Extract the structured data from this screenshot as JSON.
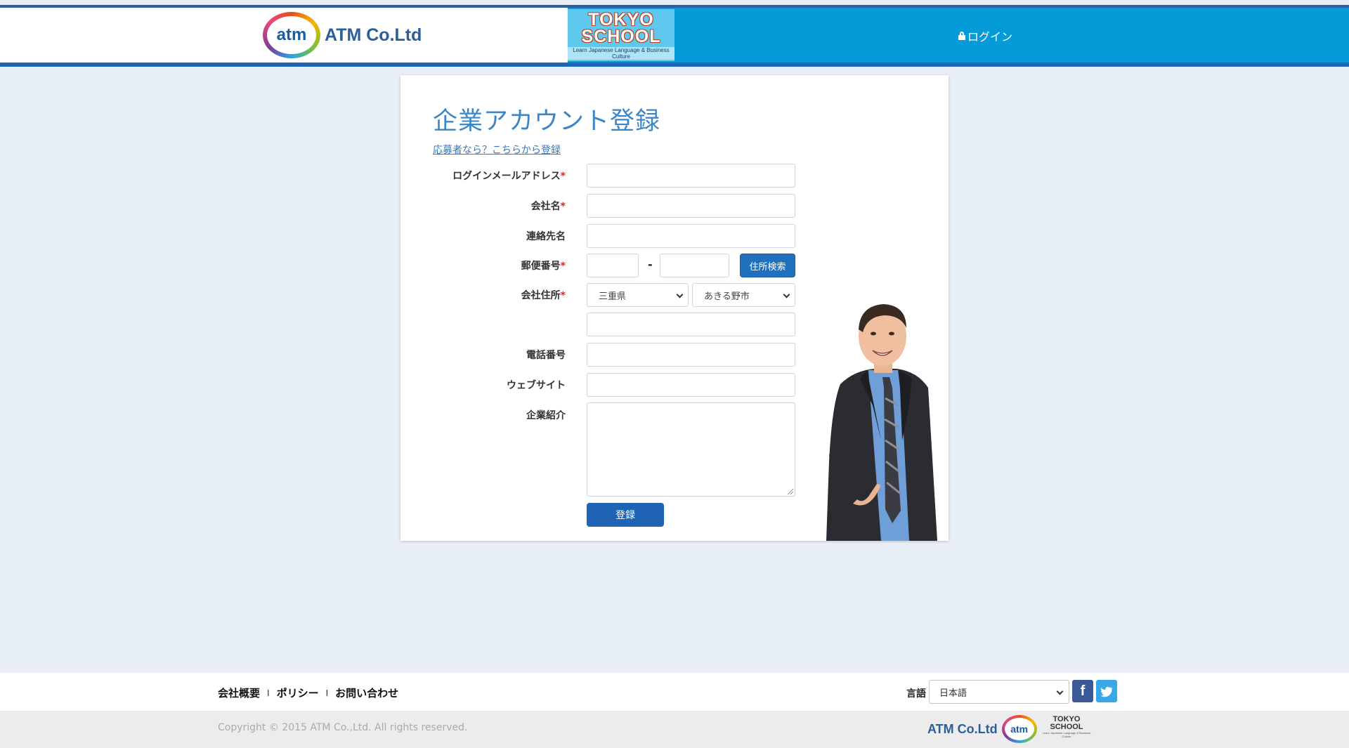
{
  "header": {
    "atm_logo_text": "atm",
    "company_name": "ATM Co.Ltd",
    "tokyo_line1": "TOKYO",
    "tokyo_line2": "SCHOOL",
    "tokyo_tagline": "Learn Japanese Language & Business Culture",
    "login_label": "ログイン",
    "colors": {
      "header_blue": "#049bd8",
      "header_line": "#1d66b3"
    }
  },
  "form": {
    "title": "企業アカウント登録",
    "applicant_link": "応募者なら？こちらから登録",
    "fields": {
      "login_email": {
        "label": "ログインメールアドレス",
        "required": "*",
        "value": ""
      },
      "company_name": {
        "label": "会社名",
        "required": "*",
        "value": ""
      },
      "contact_name": {
        "label": "連絡先名",
        "value": ""
      },
      "postal_code": {
        "label": "郵便番号",
        "required": "*",
        "value1": "",
        "value2": "",
        "separator": "-"
      },
      "company_address": {
        "label": "会社住所",
        "required": "*",
        "prefecture": "三重県",
        "city": "あきる野市",
        "street": ""
      },
      "phone": {
        "label": "電話番号",
        "value": ""
      },
      "website": {
        "label": "ウェブサイト",
        "value": ""
      },
      "company_intro": {
        "label": "企業紹介",
        "value": ""
      }
    },
    "address_search_button": "住所検索",
    "register_button": "登録"
  },
  "footer": {
    "links": [
      "会社概要",
      "ポリシー",
      "お問い合わせ"
    ],
    "separator": "I",
    "language_label": "言語",
    "language_selected": "日本語",
    "facebook_glyph": "f",
    "copyright": "Copyright © 2015 ATM Co.,Ltd. All rights reserved.",
    "atm_name": "ATM Co.Ltd",
    "atm_logo_text": "atm",
    "tokyo_line1": "TOKYO",
    "tokyo_line2": "SCHOOL",
    "tokyo_tagline": "Learn Japanese Language & Business Culture"
  }
}
